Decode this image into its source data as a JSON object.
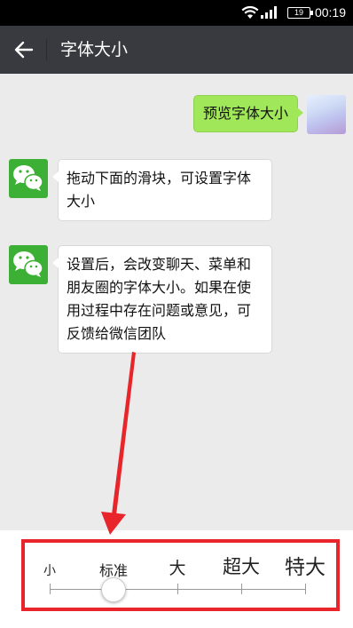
{
  "status_bar": {
    "time": "00:19",
    "battery": "19",
    "wifi_icon": "wifi-icon",
    "signal_icon": "signal-icon"
  },
  "app_bar": {
    "back_icon": "arrow-left-icon",
    "title": "字体大小"
  },
  "chat": {
    "outgoing": {
      "text": "预览字体大小"
    },
    "incoming": [
      {
        "text": "拖动下面的滑块，可设置字体大小",
        "avatar_icon": "wechat-logo-icon"
      },
      {
        "text": "设置后，会改变聊天、菜单和朋友圈的字体大小。如果在使用过程中存在问题或意见，可反馈给微信团队",
        "avatar_icon": "wechat-logo-icon"
      }
    ]
  },
  "font_size_slider": {
    "options": [
      "小",
      "标准",
      "大",
      "超大",
      "特大"
    ],
    "selected": "标准",
    "selected_index": 1
  },
  "colors": {
    "app_bar": "#393a3f",
    "outgoing_bubble": "#a0e75a",
    "wechat_green": "#3cb034",
    "highlight": "#e8252b"
  }
}
